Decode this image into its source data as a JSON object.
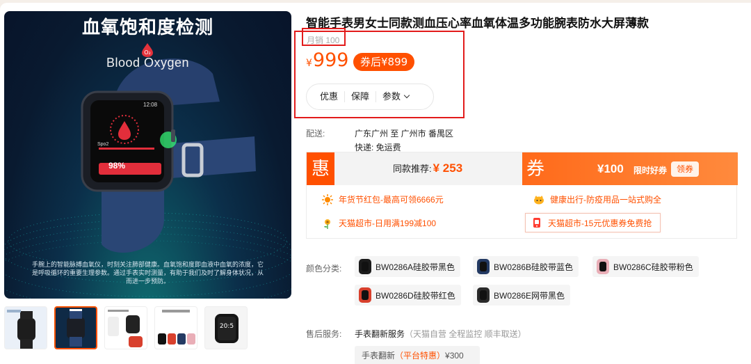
{
  "product": {
    "title": "智能手表男女士同款测血压心率血氧体温多功能腕表防水大屏薄款",
    "sales": "月销 100",
    "price_symbol": "¥",
    "price": "999",
    "coupon_price": "券后¥899"
  },
  "hero": {
    "title": "血氧饱和度检测",
    "o2": "O₂",
    "subtitle": "Blood Oxygen",
    "watch_time": "12:08",
    "watch_label": "Spo2",
    "watch_percent": "98%",
    "caption": "手腕上的智能脉搏血氧仪，时刻关注肺部健康。血氧饱和度即血液中血氧的浓度，它是呼吸循环的重要生理参数。通过手表实时测量，有助于我们及时了解身体状况，从而进一步预防。"
  },
  "tabs": [
    "优惠",
    "保障",
    "参数"
  ],
  "delivery": {
    "label": "配送:",
    "route": "广东广州 至 广州市 番禺区",
    "shipping": "快递: 免运费"
  },
  "promo": {
    "hui_char": "惠",
    "recommend_label": "同款推荐:",
    "recommend_price": "¥ 253",
    "quan_char": "券",
    "coupon_amount": "¥100",
    "coupon_tag": "限时好券",
    "coupon_button": "领券",
    "items": [
      "年货节红包-最高可领6666元",
      "健康出行-防疫用品一站式购全",
      "天猫超市-日用满199减100",
      "天猫超市-15元优惠券免费抢"
    ]
  },
  "colors": {
    "label": "颜色分类:",
    "options": [
      {
        "name": "BW0286A硅胶带黑色",
        "color": "#1b1b1b"
      },
      {
        "name": "BW0286B硅胶带蓝色",
        "color": "#243a63"
      },
      {
        "name": "BW0286C硅胶带粉色",
        "color": "#e9aeb7"
      },
      {
        "name": "BW0286D硅胶带红色",
        "color": "#d8402d"
      },
      {
        "name": "BW0286E网带黑色",
        "color": "#2a2a2a"
      }
    ]
  },
  "after_sales": {
    "label": "售后服务:",
    "service": "手表翻新服务",
    "service_note": "（天猫自营 全程监控 顺丰取送）",
    "option_name": "手表翻新",
    "option_tag": "（平台特惠）",
    "option_price": "¥300"
  },
  "theme": {
    "accent": "#ff5000",
    "highlight_border": "#e21b1b"
  }
}
